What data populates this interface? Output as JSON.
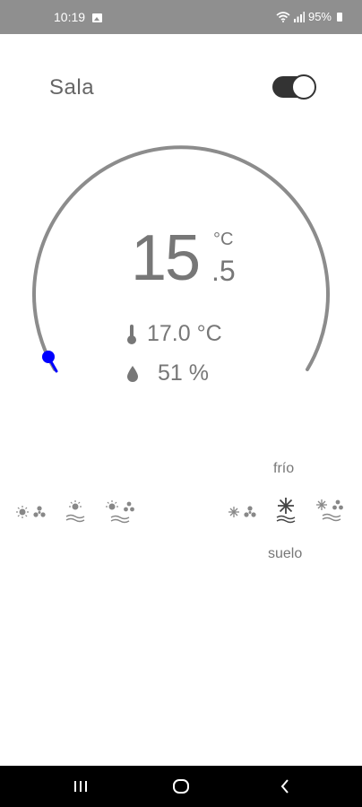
{
  "status_bar": {
    "time": "10:19",
    "battery": "95%"
  },
  "room": {
    "name": "Sala",
    "power_on": true
  },
  "thermostat": {
    "setpoint_integer": "15",
    "setpoint_decimal": ".5",
    "setpoint_unit": "°C",
    "current_temperature": "17.0 °C",
    "humidity": "51 %"
  },
  "modes": {
    "cold_label": "frío",
    "floor_label": "suelo",
    "heat": [
      "sun-fan",
      "sun-floor",
      "sun-fan-floor"
    ],
    "cool": [
      "snow-fan",
      "snowflake",
      "snow-fan-floor"
    ]
  },
  "colors": {
    "accent": "#0000ff",
    "arc": "#8c8c8c",
    "status_bar": "#8f8f8f"
  },
  "nav": [
    "recents-icon",
    "home-icon",
    "back-icon"
  ]
}
